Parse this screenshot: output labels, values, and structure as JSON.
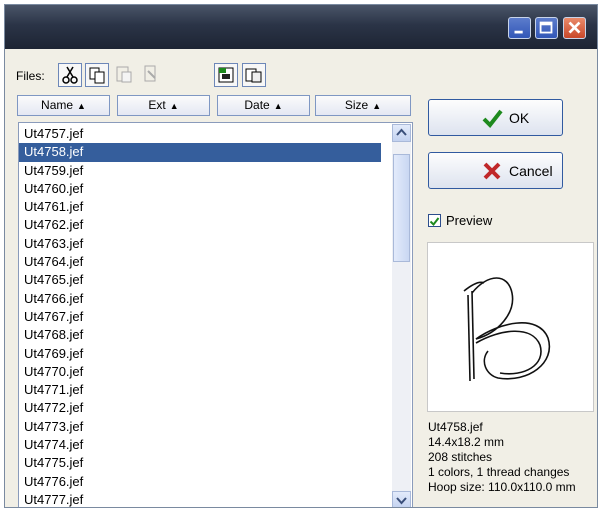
{
  "titlebar": {
    "icons": [
      "minimize-icon",
      "maximize-icon",
      "close-icon"
    ]
  },
  "toolbar": {
    "files_label": "Files:",
    "tools": [
      "cut-icon",
      "copy-icon",
      "paste-icon",
      "rename-icon",
      "embroidery-view-icon",
      "move-file-icon"
    ]
  },
  "columns": [
    {
      "label": "Name",
      "sort": "ascending"
    },
    {
      "label": "Ext",
      "sort": "ascending"
    },
    {
      "label": "Date",
      "sort": "ascending"
    },
    {
      "label": "Size",
      "sort": "ascending"
    }
  ],
  "file_list": {
    "selected": "Ut4758.jef",
    "items": [
      "Ut4757.jef",
      "Ut4758.jef",
      "Ut4759.jef",
      "Ut4760.jef",
      "Ut4761.jef",
      "Ut4762.jef",
      "Ut4763.jef",
      "Ut4764.jef",
      "Ut4765.jef",
      "Ut4766.jef",
      "Ut4767.jef",
      "Ut4768.jef",
      "Ut4769.jef",
      "Ut4770.jef",
      "Ut4771.jef",
      "Ut4772.jef",
      "Ut4773.jef",
      "Ut4774.jef",
      "Ut4775.jef",
      "Ut4776.jef",
      "Ut4777.jef"
    ]
  },
  "buttons": {
    "ok": "OK",
    "cancel": "Cancel"
  },
  "preview": {
    "label": "Preview",
    "checked": true,
    "info": {
      "filename": "Ut4758.jef",
      "dimensions": "14.4x18.2 mm",
      "stitches": "208 stitches",
      "colors": "1 colors, 1 thread changes",
      "hoop": "Hoop size: 110.0x110.0 mm"
    }
  },
  "colors": {
    "title_bar": "#2b3447",
    "selection": "#355e9c",
    "dialog_bg": "#f1efe6",
    "ok_check": "#1e8a1e",
    "cancel_x": "#c0282a"
  }
}
